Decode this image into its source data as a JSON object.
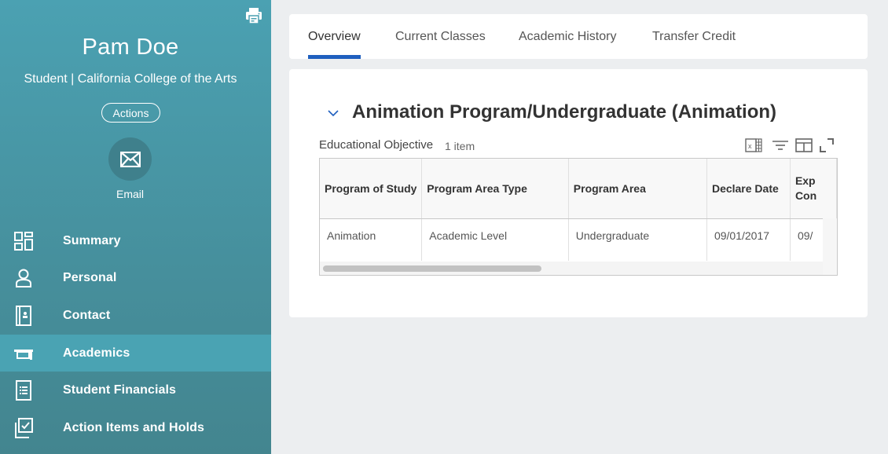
{
  "profile": {
    "name": "Pam Doe",
    "subtitle": "Student | California College of the Arts",
    "actions_label": "Actions",
    "email_label": "Email",
    "print_icon": "printer-icon",
    "email_icon": "envelope-icon"
  },
  "sidebar": {
    "items": [
      {
        "label": "Summary",
        "icon": "dashboard-icon",
        "active": false
      },
      {
        "label": "Personal",
        "icon": "person-icon",
        "active": false
      },
      {
        "label": "Contact",
        "icon": "contact-book-icon",
        "active": false
      },
      {
        "label": "Academics",
        "icon": "graduation-cap-icon",
        "active": true
      },
      {
        "label": "Student Financials",
        "icon": "list-document-icon",
        "active": false
      },
      {
        "label": "Action Items and Holds",
        "icon": "checkbox-stack-icon",
        "active": false
      }
    ]
  },
  "tabs": [
    {
      "label": "Overview",
      "active": true
    },
    {
      "label": "Current Classes",
      "active": false
    },
    {
      "label": "Academic History",
      "active": false
    },
    {
      "label": "Transfer Credit",
      "active": false
    }
  ],
  "section": {
    "title": "Animation Program/Undergraduate (Animation)",
    "table_label": "Educational Objective",
    "item_count": "1 item",
    "tools": [
      "excel-export-icon",
      "filter-icon",
      "columns-icon",
      "fullscreen-icon"
    ],
    "columns": [
      "Program of Study",
      "Program Area Type",
      "Program Area",
      "Declare Date",
      "Exp Con"
    ],
    "rows": [
      [
        "Animation",
        "Academic Level",
        "Undergraduate",
        "09/01/2017",
        "09/"
      ]
    ]
  },
  "colors": {
    "sidebar": "#4a9aab",
    "active_nav": "#4aa3b3",
    "tab_indicator": "#1f5fbf",
    "page_bg": "#eceef0"
  }
}
